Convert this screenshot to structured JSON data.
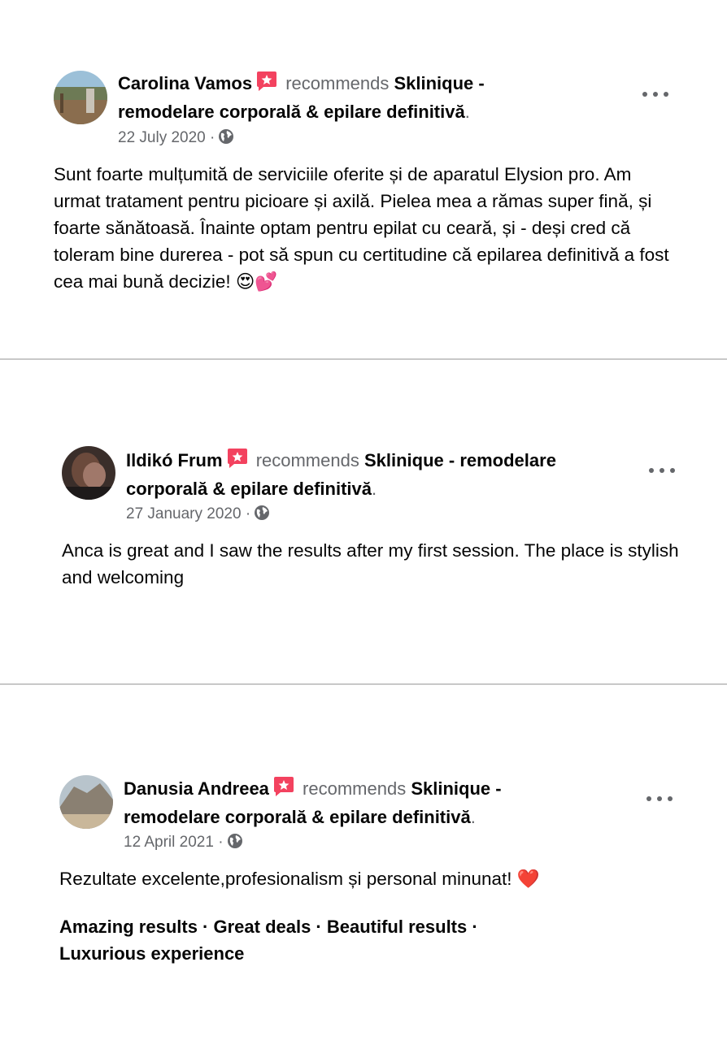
{
  "reviews": [
    {
      "author": "Carolina Vamos",
      "recommends_text": "recommends",
      "page_name": "Sklinique - remodelare corporală & epilare definitivă",
      "period": ".",
      "date": "22 July 2020 ·",
      "text": "Sunt foarte mulțumită de serviciile oferite și de aparatul Elysion pro. Am urmat tratament pentru picioare și axilă. Pielea mea a rămas super fină, și foarte sănătoasă. Înainte optam pentru epilat cu ceară, și - deși cred că toleram bine durerea - pot să spun cu certitudine că epilarea definitivă a fost cea mai bună decizie!",
      "emoji": "😍💕"
    },
    {
      "author": "Ildikó Frum",
      "recommends_text": "recommends",
      "page_name": "Sklinique - remodelare corporală & epilare definitivă",
      "period": ".",
      "date": "27 January 2020 ·",
      "text": "Anca is great and I saw the results after my first session. The place is stylish and welcoming"
    },
    {
      "author": "Danusia Andreea",
      "recommends_text": "recommends",
      "page_name": "Sklinique - remodelare corporală & epilare definitivă",
      "period": ".",
      "date": "12 April 2021 ·",
      "text": "Rezultate excelente,profesionalism și personal minunat!",
      "emoji": "❤️",
      "tags": "Amazing results · Great deals · Beautiful results · Luxurious experience"
    }
  ],
  "colors": {
    "recommend_badge": "#f3425f",
    "secondary_text": "#65676b",
    "divider": "#c8c8c8"
  },
  "icons": {
    "badge": "recommend-badge-icon",
    "globe": "globe-icon",
    "more": "more-options-icon"
  }
}
